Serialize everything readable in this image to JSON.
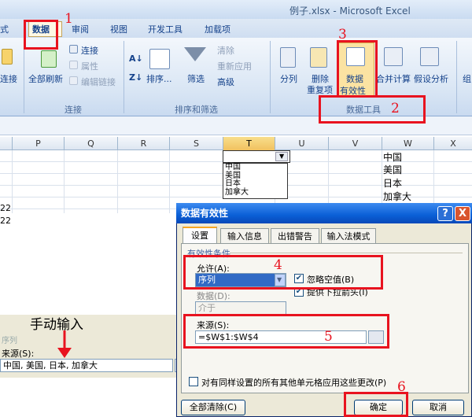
{
  "window": {
    "title": "例子.xlsx - Microsoft Excel"
  },
  "tabs": [
    "式",
    "数据",
    "审阅",
    "视图",
    "开发工具",
    "加载项"
  ],
  "ribbon": {
    "connections": {
      "label": "连接",
      "refresh_all": "全部刷新",
      "connect": "连接",
      "properties": "属性",
      "edit_links": "编辑链接",
      "left_btn": "连接"
    },
    "sort_filter": {
      "label": "排序和筛选",
      "sort": "排序...",
      "filter": "筛选",
      "clear": "清除",
      "reapply": "重新应用",
      "advanced": "高级"
    },
    "data_tools": {
      "label": "数据工具",
      "text_to_columns": "分列",
      "remove_dup_1": "删除",
      "remove_dup_2": "重复项",
      "data_validation_1": "数据",
      "data_validation_2": "有效性",
      "consolidate": "合并计算",
      "what_if": "假设分析",
      "group": "组"
    }
  },
  "columns": [
    "P",
    "Q",
    "R",
    "S",
    "T",
    "U",
    "V",
    "W",
    "X"
  ],
  "row_values": [
    "22",
    "22"
  ],
  "col_w_cells": [
    "中国",
    "美国",
    "日本",
    "加拿大"
  ],
  "dropdown_items": [
    "中国",
    "美国",
    "日本",
    "加拿大"
  ],
  "dialog": {
    "title": "数据有效性",
    "help": "?",
    "close": "X",
    "tabs": [
      "设置",
      "输入信息",
      "出错警告",
      "输入法模式"
    ],
    "section": "有效性条件",
    "allow_label": "允许(A):",
    "allow_value": "序列",
    "ignore_blank": "忽略空值(B)",
    "dropdown_opt": "提供下拉箭头(I)",
    "data_label": "数据(D):",
    "data_value": "介于",
    "source_label": "来源(S):",
    "source_value": "=$W$1:$W$4",
    "apply_all": "对有同样设置的所有其他单元格应用这些更改(P)",
    "clear_all": "全部清除(C)",
    "ok": "确定",
    "cancel": "取消"
  },
  "manual": {
    "caption": "手动输入",
    "source_label": "来源(S):",
    "source_value": "中国, 美国, 日本, 加拿大",
    "faded": "序列"
  },
  "annotations": [
    "1",
    "2",
    "3",
    "4",
    "5",
    "6"
  ],
  "colors": {
    "annotation": "#e8131f",
    "dialog_title": "#0a5fd6",
    "highlight": "#316ac5"
  }
}
